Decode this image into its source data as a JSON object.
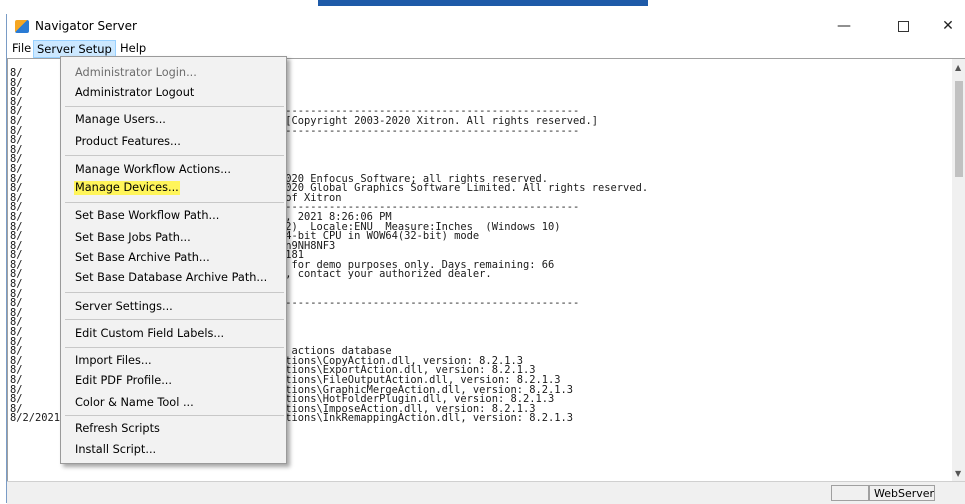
{
  "window": {
    "title": "Navigator Server",
    "controls": {
      "minimize": "—",
      "close": "✕"
    }
  },
  "menubar": {
    "file": "File",
    "server_setup": "Server Setup",
    "help": "Help"
  },
  "dropdown": {
    "items": [
      {
        "label": "Administrator Login...",
        "disabled": true
      },
      {
        "label": "Administrator Logout"
      },
      {
        "label": "Manage Users..."
      },
      {
        "label": "Product Features..."
      },
      {
        "label": "Manage Workflow Actions..."
      },
      {
        "label": "Manage Devices...",
        "highlighted": true
      },
      {
        "label": "Set Base Workflow Path..."
      },
      {
        "label": "Set Base Jobs Path..."
      },
      {
        "label": "Set Base Archive Path..."
      },
      {
        "label": "Set Base Database Archive Path..."
      },
      {
        "label": "Server Settings..."
      },
      {
        "label": "Edit Custom Field Labels..."
      },
      {
        "label": "Import Files..."
      },
      {
        "label": "Edit PDF Profile..."
      },
      {
        "label": "Color & Name Tool ..."
      },
      {
        "label": "Refresh Scripts"
      },
      {
        "label": "Install Script..."
      }
    ],
    "highlight_color": "#fff55a"
  },
  "console": {
    "lines": [
      "8/",
      "8/",
      "8/",
      "8/",
      "8/                                 --------------------------------------------------------",
      "8/                                 n: 8.2.1 [Copyright 2003-2020 Xitron. All rights reserved.]",
      "8/                                 --------------------------------------------------------",
      "8/",
      "8/",
      "8/",
      "8/",
      "8/                                 ht 1999-2020 Enfocus Software; all rights reserved.",
      "8/                                 ht 2003-2020 Global Graphics Software Limited. All rights reserved.",
      "8/                                 rademark of Xitron",
      "8/                                 --------------------------------------------------------",
      "8/                                  August 2, 2021 8:26:06 PM",
      "8/                                 uild 19042)  Locale:ENU  Measure:Inches  (Windows 10)",
      "8/                                 ecture: 64-bit CPU in WOW64(32-bit) mode",
      "8/                                 is: xitron9NH8NF3",
      "8/                                 number: 5181",
      "8/                                  licensed for demo purposes only. Days remaining: 66",
      "8/                                  software, contact your authorized dealer.",
      "8/",
      "8/",
      "8/                                 --------------------------------------------------------",
      "8/",
      "8/                                  .",
      "8/",
      "8/",
      "8/                                 aded main actions database",
      "8/                                 igator\\Actions\\CopyAction.dll, version: 8.2.1.3",
      "8/                                 igator\\Actions\\ExportAction.dll, version: 8.2.1.3",
      "8/                                 igator\\Actions\\FileOutputAction.dll, version: 8.2.1.3",
      "8/                                 igator\\Actions\\GraphicMergeAction.dll, version: 8.2.1.3",
      "8/                                 igator\\Actions\\HotFolderPlugin.dll, version: 8.2.1.3",
      "8/                                 igator\\Actions\\ImposeAction.dll, version: 8.2.1.3",
      "8/2/2021 20:26:11: C:\\Navigator\\Navigator\\Actions\\InkRemappingAction.dll, version: 8.2.1.3"
    ]
  },
  "scrollbar": {
    "up_arrow": "▲",
    "down_arrow": "▼"
  },
  "statusbar": {
    "field1": "",
    "field2": "WebServer"
  }
}
